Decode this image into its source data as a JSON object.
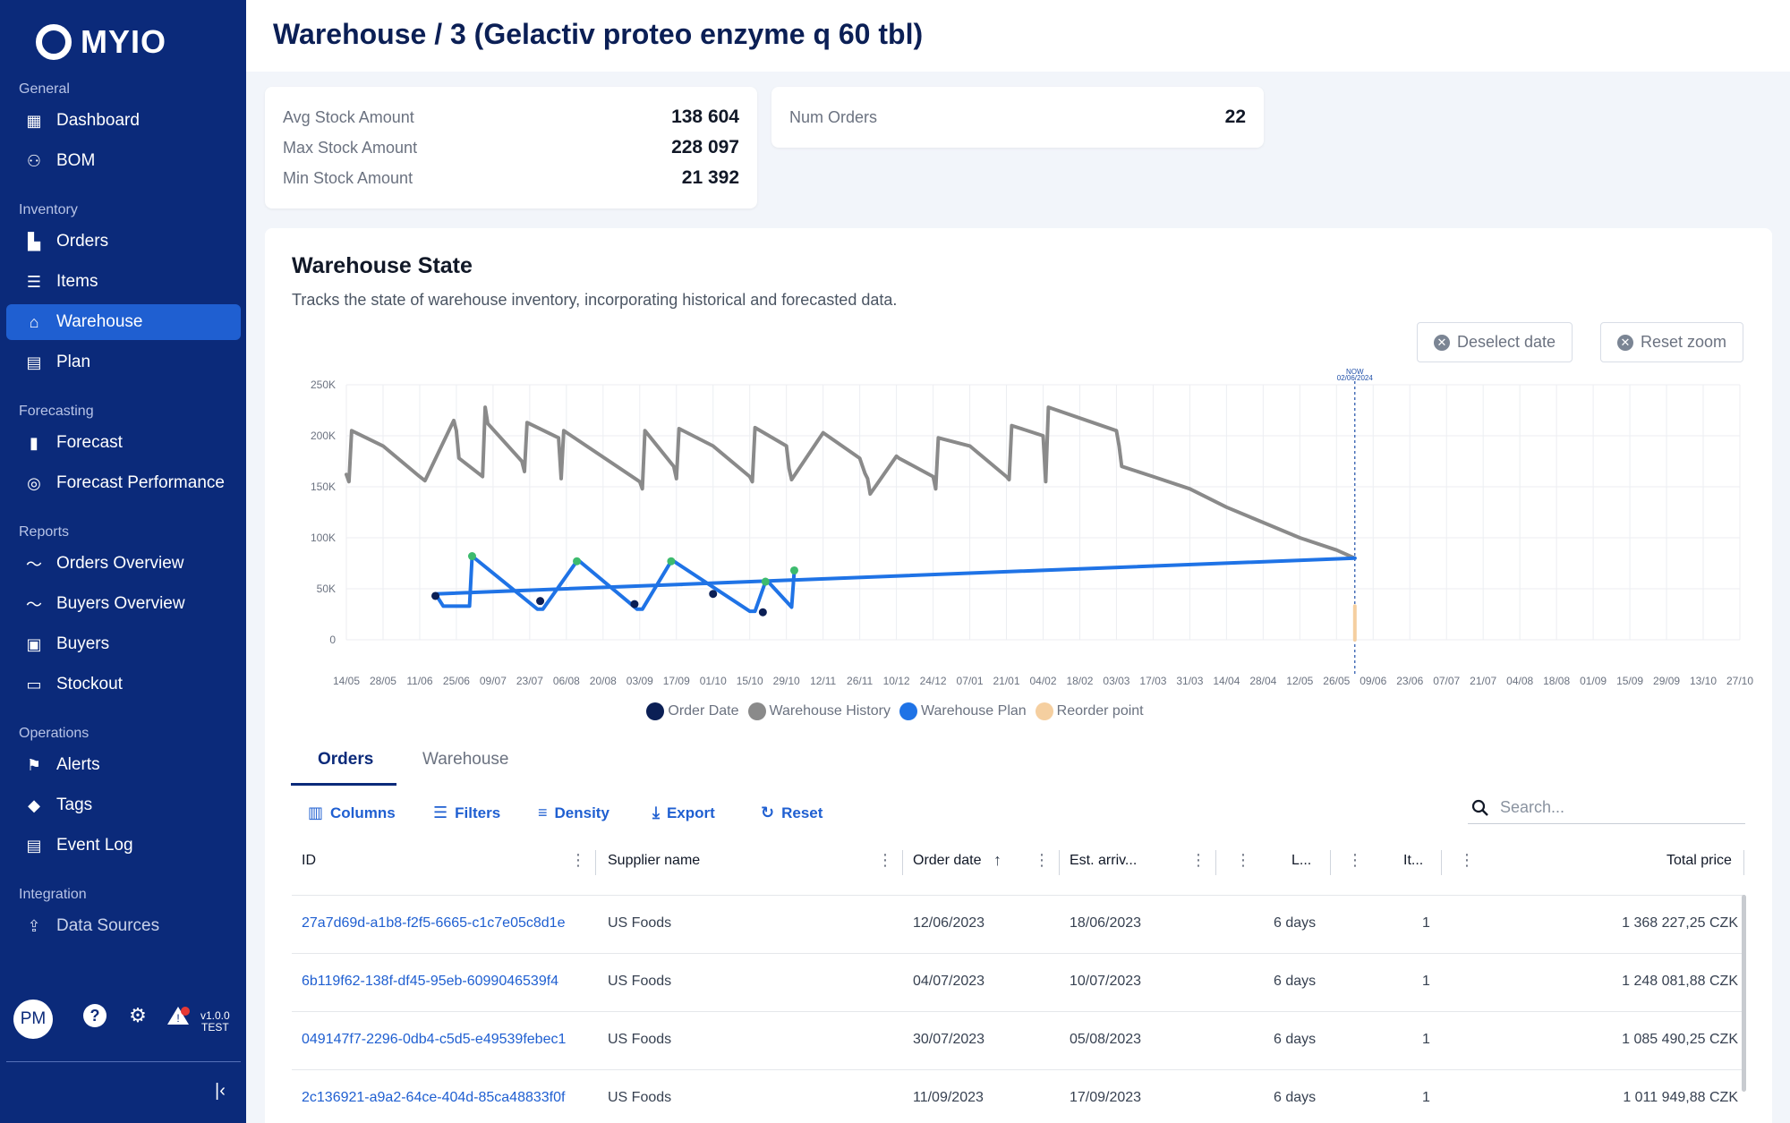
{
  "app": {
    "logo_text": "MYIO"
  },
  "sidebar": {
    "sections": [
      {
        "title": "General",
        "items": [
          {
            "label": "Dashboard",
            "icon": "dashboard-icon"
          },
          {
            "label": "BOM",
            "icon": "hierarchy-icon"
          }
        ]
      },
      {
        "title": "Inventory",
        "items": [
          {
            "label": "Orders",
            "icon": "orders-icon"
          },
          {
            "label": "Items",
            "icon": "list-icon"
          },
          {
            "label": "Warehouse",
            "icon": "warehouse-icon",
            "active": true
          },
          {
            "label": "Plan",
            "icon": "plan-icon"
          }
        ]
      },
      {
        "title": "Forecasting",
        "items": [
          {
            "label": "Forecast",
            "icon": "bar-chart-icon"
          },
          {
            "label": "Forecast Performance",
            "icon": "performance-icon"
          }
        ]
      },
      {
        "title": "Reports",
        "items": [
          {
            "label": "Orders Overview",
            "icon": "trend-icon"
          },
          {
            "label": "Buyers Overview",
            "icon": "trend-icon"
          },
          {
            "label": "Buyers",
            "icon": "briefcase-icon"
          },
          {
            "label": "Stockout",
            "icon": "stockout-icon"
          }
        ]
      },
      {
        "title": "Operations",
        "items": [
          {
            "label": "Alerts",
            "icon": "alert-icon"
          },
          {
            "label": "Tags",
            "icon": "tag-icon"
          },
          {
            "label": "Event Log",
            "icon": "log-icon"
          }
        ]
      },
      {
        "title": "Integration",
        "items": [
          {
            "label": "Data Sources",
            "icon": "upload-icon"
          }
        ]
      }
    ],
    "footer": {
      "avatar": "PM",
      "alert_count": "1",
      "version": "v1.0.0",
      "env": "TEST"
    }
  },
  "header": {
    "title": "Warehouse / 3 (Gelactiv proteo enzyme q 60 tbl)"
  },
  "stats": {
    "avg_label": "Avg Stock Amount",
    "avg_value": "138 604",
    "max_label": "Max Stock Amount",
    "max_value": "228 097",
    "min_label": "Min Stock Amount",
    "min_value": "21 392",
    "orders_label": "Num Orders",
    "orders_value": "22"
  },
  "panel": {
    "title": "Warehouse State",
    "description": "Tracks the state of warehouse inventory, incorporating historical and forecasted data.",
    "deselect_label": "Deselect date",
    "reset_zoom_label": "Reset zoom"
  },
  "chart_data": {
    "type": "line",
    "now_label": "NOW",
    "now_date": "02/06/2024",
    "ylim": [
      0,
      250000
    ],
    "y_ticks": [
      "0",
      "50K",
      "100K",
      "150K",
      "200K",
      "250K"
    ],
    "x_ticks": [
      "14/05",
      "28/05",
      "11/06",
      "25/06",
      "09/07",
      "23/07",
      "06/08",
      "20/08",
      "03/09",
      "17/09",
      "01/10",
      "15/10",
      "29/10",
      "12/11",
      "26/11",
      "10/12",
      "24/12",
      "07/01",
      "21/01",
      "04/02",
      "18/02",
      "03/03",
      "17/03",
      "31/03",
      "14/04",
      "28/04",
      "12/05",
      "26/05",
      "09/06",
      "23/06",
      "07/07",
      "21/07",
      "04/08",
      "18/08",
      "01/09",
      "15/09",
      "29/09",
      "13/10",
      "27/10"
    ],
    "colors": {
      "order_date": "#0b1f55",
      "history": "#8a8a8a",
      "plan": "#1f73e6",
      "reorder": "#f5cfa0",
      "peak_marker": "#3dbb6e"
    },
    "series": [
      {
        "name": "Warehouse History",
        "x": [
          "14/05",
          "15/05",
          "16/05",
          "28/05",
          "11/06",
          "13/06",
          "24/06",
          "25/06",
          "26/06",
          "05/07",
          "06/07",
          "07/07",
          "20/07",
          "21/07",
          "22/07",
          "03/08",
          "04/08",
          "05/08",
          "03/09",
          "04/09",
          "05/09",
          "16/09",
          "17/09",
          "18/09",
          "01/10",
          "15/10",
          "16/10",
          "17/10",
          "29/10",
          "30/10",
          "31/10",
          "12/11",
          "26/11",
          "28/11",
          "29/11",
          "30/11",
          "10/12",
          "11/12",
          "24/12",
          "25/12",
          "26/12",
          "07/01",
          "21/01",
          "22/01",
          "23/01",
          "04/02",
          "05/02",
          "06/02",
          "03/03",
          "04/03",
          "05/03",
          "17/03",
          "31/03",
          "14/04",
          "28/04",
          "12/05",
          "26/05",
          "02/06"
        ],
        "values": [
          162000,
          155000,
          205000,
          190000,
          160000,
          156000,
          215000,
          205000,
          178000,
          160000,
          228000,
          212000,
          175000,
          165000,
          213000,
          198000,
          158000,
          205000,
          155000,
          148000,
          205000,
          170000,
          158000,
          207000,
          190000,
          160000,
          155000,
          208000,
          190000,
          168000,
          157000,
          203000,
          178000,
          163000,
          158000,
          143000,
          180000,
          178000,
          160000,
          148000,
          198000,
          190000,
          160000,
          157000,
          210000,
          200000,
          155000,
          228000,
          205000,
          190000,
          170000,
          160000,
          148000,
          130000,
          115000,
          100000,
          88000,
          80000
        ]
      },
      {
        "name": "Warehouse Plan",
        "x": [
          "02/06",
          "17/06",
          "20/06",
          "30/06",
          "01/07",
          "26/07",
          "28/07",
          "10/08",
          "11/08",
          "02/09",
          "04/09",
          "15/09",
          "16/09",
          "15/10",
          "17/10",
          "21/10",
          "22/10",
          "31/10",
          "01/11"
        ],
        "values": [
          80000,
          45000,
          33000,
          33000,
          82000,
          30000,
          30000,
          77000,
          77000,
          30000,
          30000,
          77000,
          77000,
          28000,
          28000,
          57000,
          57000,
          32000,
          68000
        ]
      },
      {
        "name": "Reorder point",
        "x": [
          "02/06",
          "28/06",
          "29/06",
          "01/07",
          "28/07",
          "29/07",
          "01/08",
          "01/09",
          "02/09",
          "04/09",
          "29/09",
          "30/09",
          "01/10",
          "22/10",
          "23/10",
          "01/11"
        ],
        "values": [
          33000,
          33000,
          0,
          33000,
          33000,
          0,
          33000,
          33000,
          0,
          33000,
          33000,
          0,
          33000,
          33000,
          0,
          0
        ]
      }
    ],
    "order_date_points": {
      "x": [
        "17/06",
        "27/07",
        "01/09",
        "01/10",
        "20/10"
      ],
      "values": [
        43000,
        38000,
        35000,
        45000,
        27000
      ]
    }
  },
  "tabs": {
    "orders": "Orders",
    "warehouse": "Warehouse"
  },
  "toolbar": {
    "columns": "Columns",
    "filters": "Filters",
    "density": "Density",
    "export": "Export",
    "reset": "Reset",
    "search_placeholder": "Search..."
  },
  "table": {
    "headers": {
      "id": "ID",
      "supplier": "Supplier name",
      "order_date": "Order date",
      "est_arrival": "Est. arriv...",
      "lead": "L...",
      "items": "It...",
      "total": "Total price"
    },
    "rows": [
      {
        "id": "27a7d69d-a1b8-f2f5-6665-c1c7e05c8d1e",
        "supplier": "US Foods",
        "order_date": "12/06/2023",
        "est_arrival": "18/06/2023",
        "lead": "6 days",
        "items": "1",
        "total": "1 368 227,25 CZK"
      },
      {
        "id": "6b119f62-138f-df45-95eb-6099046539f4",
        "supplier": "US Foods",
        "order_date": "04/07/2023",
        "est_arrival": "10/07/2023",
        "lead": "6 days",
        "items": "1",
        "total": "1 248 081,88 CZK"
      },
      {
        "id": "049147f7-2296-0db4-c5d5-e49539febec1",
        "supplier": "US Foods",
        "order_date": "30/07/2023",
        "est_arrival": "05/08/2023",
        "lead": "6 days",
        "items": "1",
        "total": "1 085 490,25 CZK"
      },
      {
        "id": "2c136921-a9a2-64ce-404d-85ca48833f0f",
        "supplier": "US Foods",
        "order_date": "11/09/2023",
        "est_arrival": "17/09/2023",
        "lead": "6 days",
        "items": "1",
        "total": "1 011 949,88 CZK"
      }
    ]
  }
}
